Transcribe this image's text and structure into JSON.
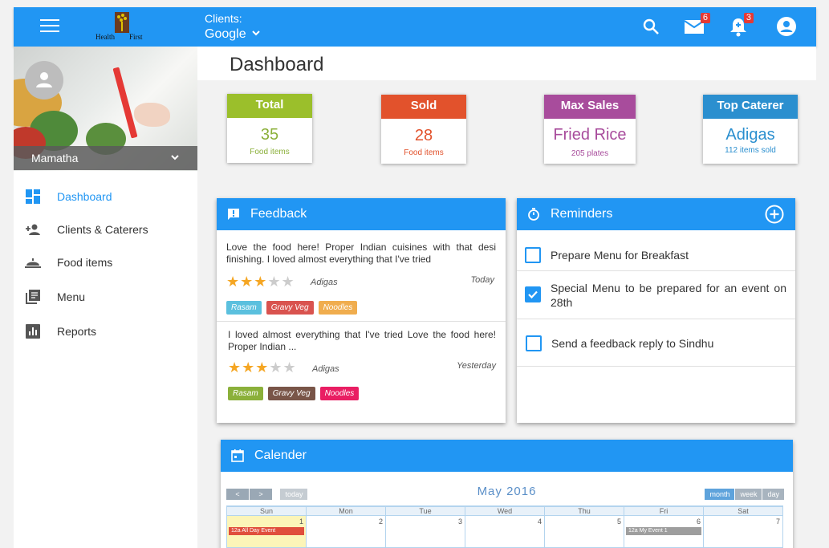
{
  "header": {
    "clients_label": "Clients:",
    "client_value": "Google",
    "logo_text": "Health First",
    "mail_count": "6",
    "notif_count": "3"
  },
  "sidebar": {
    "user_name": "Mamatha",
    "items": [
      {
        "label": "Dashboard",
        "icon": "dashboard-icon"
      },
      {
        "label": "Clients & Caterers",
        "icon": "person-add-icon"
      },
      {
        "label": "Food items",
        "icon": "cloche-icon"
      },
      {
        "label": "Menu",
        "icon": "menu-book-icon"
      },
      {
        "label": "Reports",
        "icon": "bar-chart-icon"
      }
    ]
  },
  "page": {
    "title": "Dashboard"
  },
  "stats": [
    {
      "title": "Total",
      "value": "35",
      "sub": "Food items",
      "color": "#9bbf2b",
      "text_color": "#8bb03a"
    },
    {
      "title": "Sold",
      "value": "28",
      "sub": "Food items",
      "color": "#e2522c",
      "text_color": "#e2522c"
    },
    {
      "title": "Max Sales",
      "value": "Fried Rice",
      "sub": "205 plates",
      "color": "#a84c9c",
      "text_color": "#a84c9c"
    },
    {
      "title": "Top Caterer",
      "value": "Adigas",
      "sub": "112 items sold",
      "color": "#2b8fcf",
      "text_color": "#2b8fcf"
    }
  ],
  "feedback": {
    "title": "Feedback",
    "items": [
      {
        "text": "Love the food here! Proper Indian cuisines with that desi finishing. I loved almost everything that I've tried",
        "author": "Adigas",
        "date": "Today",
        "rating": 3,
        "tags": [
          {
            "label": "Rasam",
            "color": "#5bc0de"
          },
          {
            "label": "Gravy Veg",
            "color": "#d9534f"
          },
          {
            "label": "Noodles",
            "color": "#f0ad4e"
          }
        ]
      },
      {
        "text": "I loved almost everything that I've tried Love the food here! Proper Indian ...",
        "author": "Adigas",
        "date": "Yesterday",
        "rating": 3,
        "tags": [
          {
            "label": "Rasam",
            "color": "#8bb03a"
          },
          {
            "label": "Gravy Veg",
            "color": "#795548"
          },
          {
            "label": "Noodles",
            "color": "#e91e63"
          }
        ]
      }
    ]
  },
  "reminders": {
    "title": "Reminders",
    "items": [
      {
        "text": "Prepare Menu for Breakfast",
        "checked": false
      },
      {
        "text": "Special Menu to be prepared for an event on 28th",
        "checked": true
      },
      {
        "text": "Send a feedback reply to Sindhu",
        "checked": false
      }
    ]
  },
  "calendar": {
    "title": "Calender",
    "month": "May 2016",
    "prev": "<",
    "next": ">",
    "today": "today",
    "views": [
      "month",
      "week",
      "day"
    ],
    "days": [
      "Sun",
      "Mon",
      "Tue",
      "Wed",
      "Thu",
      "Fri",
      "Sat"
    ],
    "dates": [
      "1",
      "2",
      "3",
      "4",
      "5",
      "6",
      "7"
    ],
    "events": [
      {
        "day": 0,
        "text": "12a All Day Event",
        "color": "#e04e3c"
      },
      {
        "day": 5,
        "text": "12a My Event 1",
        "color": "#9e9e9e"
      }
    ]
  }
}
